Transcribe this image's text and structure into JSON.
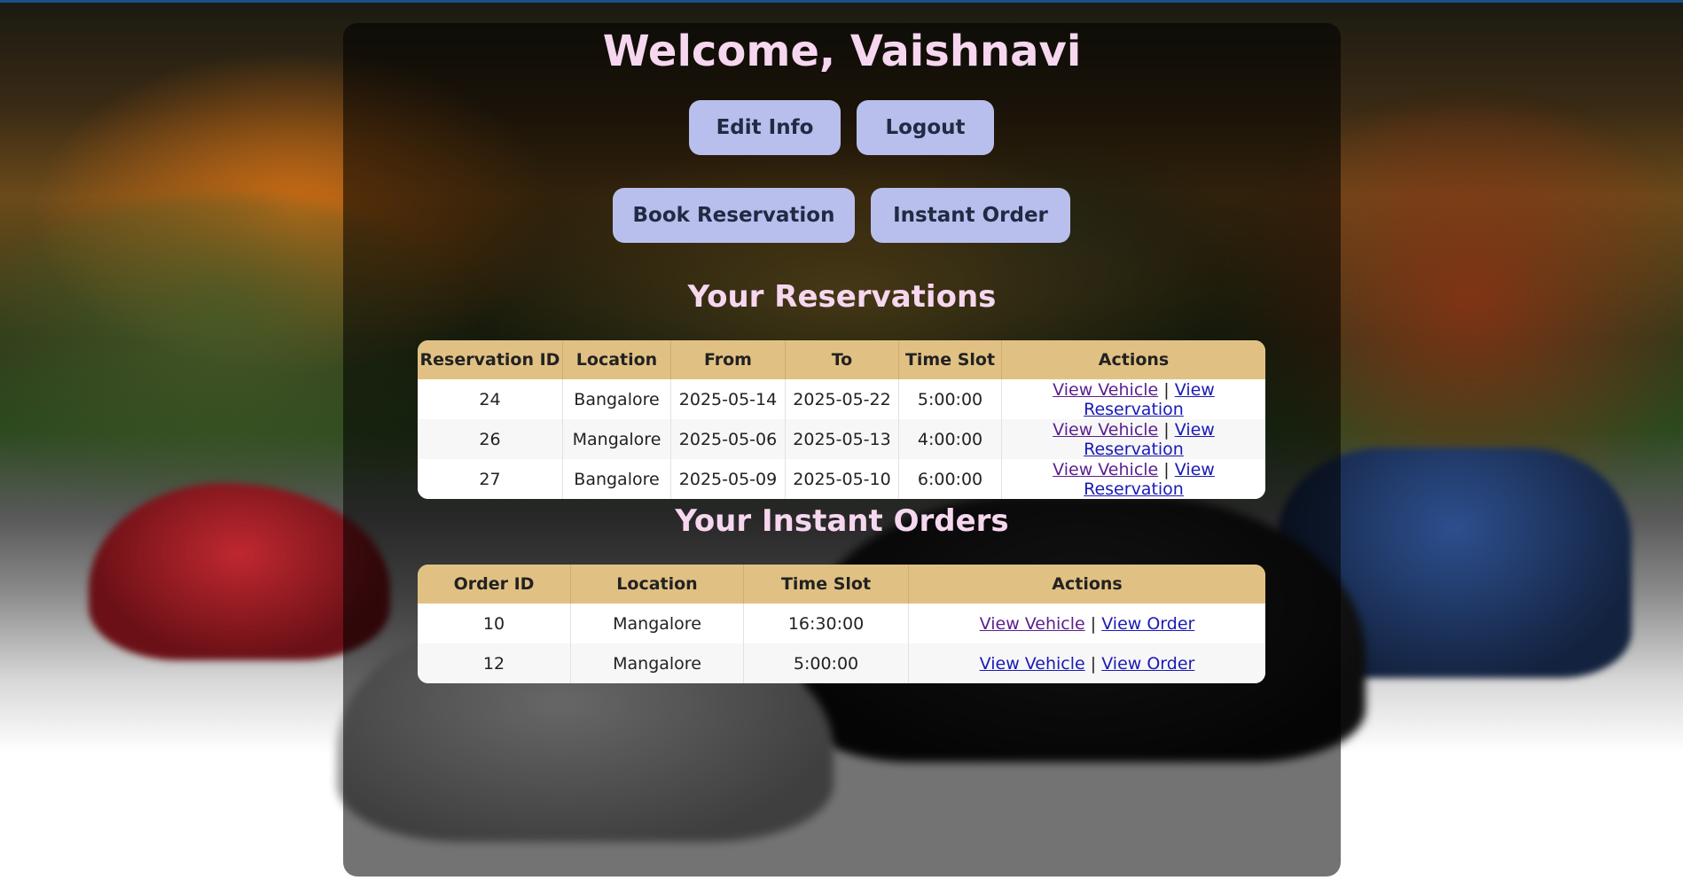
{
  "welcome": {
    "title": "Welcome, Vaishnavi"
  },
  "buttons": {
    "edit_info": "Edit Info",
    "logout": "Logout",
    "book_reservation": "Book Reservation",
    "instant_order": "Instant Order"
  },
  "reservations": {
    "heading": "Your Reservations",
    "columns": [
      "Reservation ID",
      "Location",
      "From",
      "To",
      "Time Slot",
      "Actions"
    ],
    "rows": [
      {
        "id": "24",
        "location": "Bangalore",
        "from": "2025-05-14",
        "to": "2025-05-22",
        "time_slot": "5:00:00",
        "view_vehicle": "View Vehicle",
        "separator": "|",
        "view_reservation": "View Reservation"
      },
      {
        "id": "26",
        "location": "Mangalore",
        "from": "2025-05-06",
        "to": "2025-05-13",
        "time_slot": "4:00:00",
        "view_vehicle": "View Vehicle",
        "separator": "|",
        "view_reservation": "View Reservation"
      },
      {
        "id": "27",
        "location": "Bangalore",
        "from": "2025-05-09",
        "to": "2025-05-10",
        "time_slot": "6:00:00",
        "view_vehicle": "View Vehicle",
        "separator": "|",
        "view_reservation": "View Reservation"
      }
    ]
  },
  "instant_orders": {
    "heading": "Your Instant Orders",
    "columns": [
      "Order ID",
      "Location",
      "Time Slot",
      "Actions"
    ],
    "rows": [
      {
        "id": "10",
        "location": "Mangalore",
        "time_slot": "16:30:00",
        "view_vehicle": "View Vehicle",
        "separator": "|",
        "view_order": "View Order"
      },
      {
        "id": "12",
        "location": "Mangalore",
        "time_slot": "5:00:00",
        "view_vehicle": "View Vehicle",
        "separator": "|",
        "view_order": "View Order"
      }
    ]
  },
  "colors": {
    "title": "#f7d7ef",
    "button_bg": "#b9bfec",
    "table_header_bg": "#e1c183",
    "link": "#1a1ab5",
    "visited_link": "#5b1f8f"
  }
}
